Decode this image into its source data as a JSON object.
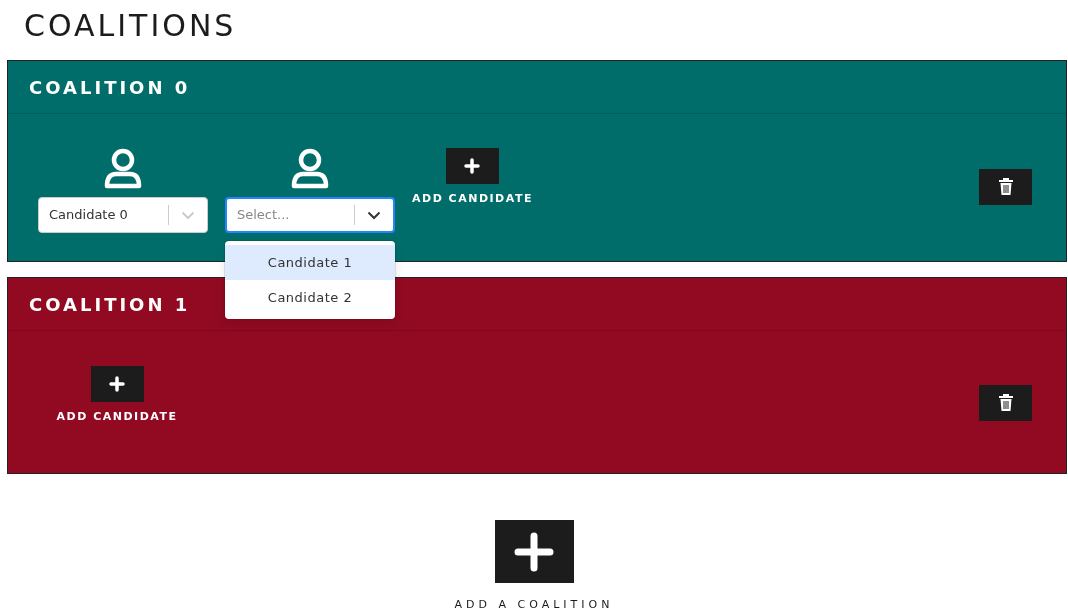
{
  "page_title": "COALITIONS",
  "coalitions": [
    {
      "title": "COALITION 0",
      "color": "#016d6b",
      "candidates": [
        {
          "value": "Candidate 0",
          "focused": false
        },
        {
          "placeholder": "Select...",
          "focused": true,
          "options": [
            {
              "label": "Candidate 1",
              "highlighted": true
            },
            {
              "label": "Candidate 2",
              "highlighted": false
            }
          ]
        }
      ],
      "add_label": "ADD CANDIDATE"
    },
    {
      "title": "COALITION 1",
      "color": "#910a22",
      "add_label": "ADD CANDIDATE"
    }
  ],
  "add_coalition_label": "ADD A COALITION"
}
